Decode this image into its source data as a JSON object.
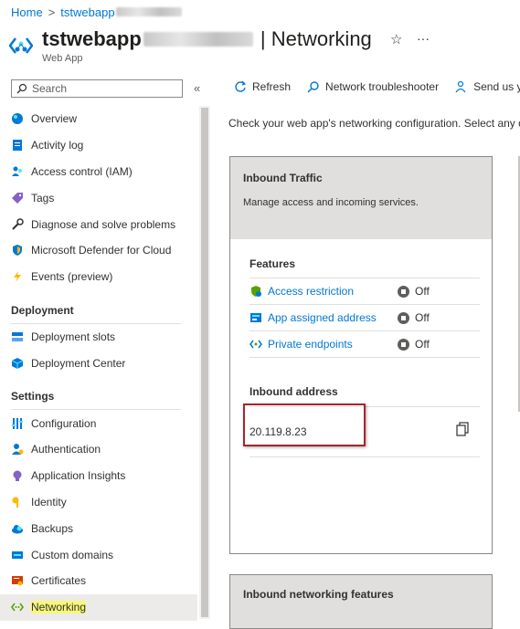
{
  "breadcrumb": {
    "home": "Home",
    "sep": ">",
    "resource": "tstwebapp"
  },
  "header": {
    "title": "tstwebapp",
    "separator": " | ",
    "section": "Networking",
    "subtitle": "Web App",
    "star": "☆",
    "more": "···"
  },
  "sidebar": {
    "search_placeholder": "Search",
    "collapse": "«",
    "items": [
      {
        "label": "Overview",
        "icon": "globe-icon"
      },
      {
        "label": "Activity log",
        "icon": "log-icon"
      },
      {
        "label": "Access control (IAM)",
        "icon": "people-icon"
      },
      {
        "label": "Tags",
        "icon": "tag-icon"
      },
      {
        "label": "Diagnose and solve problems",
        "icon": "wrench-icon"
      },
      {
        "label": "Microsoft Defender for Cloud",
        "icon": "shield-icon"
      },
      {
        "label": "Events (preview)",
        "icon": "lightning-icon"
      }
    ],
    "deployment_header": "Deployment",
    "deployment_items": [
      {
        "label": "Deployment slots",
        "icon": "slots-icon"
      },
      {
        "label": "Deployment Center",
        "icon": "cube-icon"
      }
    ],
    "settings_header": "Settings",
    "settings_items": [
      {
        "label": "Configuration",
        "icon": "sliders-icon"
      },
      {
        "label": "Authentication",
        "icon": "auth-icon"
      },
      {
        "label": "Application Insights",
        "icon": "bulb-icon"
      },
      {
        "label": "Identity",
        "icon": "key-icon"
      },
      {
        "label": "Backups",
        "icon": "cloud-icon"
      },
      {
        "label": "Custom domains",
        "icon": "domain-icon"
      },
      {
        "label": "Certificates",
        "icon": "certificate-icon"
      },
      {
        "label": "Networking",
        "icon": "network-icon"
      }
    ]
  },
  "toolbar": {
    "refresh": "Refresh",
    "troubleshooter": "Network troubleshooter",
    "send": "Send us yo"
  },
  "description": "Check your web app's networking configuration. Select any of",
  "inbound_card": {
    "title": "Inbound Traffic",
    "subtitle": "Manage access and incoming services.",
    "features_header": "Features",
    "features": [
      {
        "name": "Access restriction",
        "status": "Off"
      },
      {
        "name": "App assigned address",
        "status": "Off"
      },
      {
        "name": "Private endpoints",
        "status": "Off"
      }
    ],
    "address_header": "Inbound address",
    "address": "20.119.8.23"
  },
  "second_card": {
    "title": "Inbound networking features"
  },
  "colors": {
    "accent": "#0078d4",
    "highlight": "#f7f77a",
    "box": "#a4262c"
  }
}
